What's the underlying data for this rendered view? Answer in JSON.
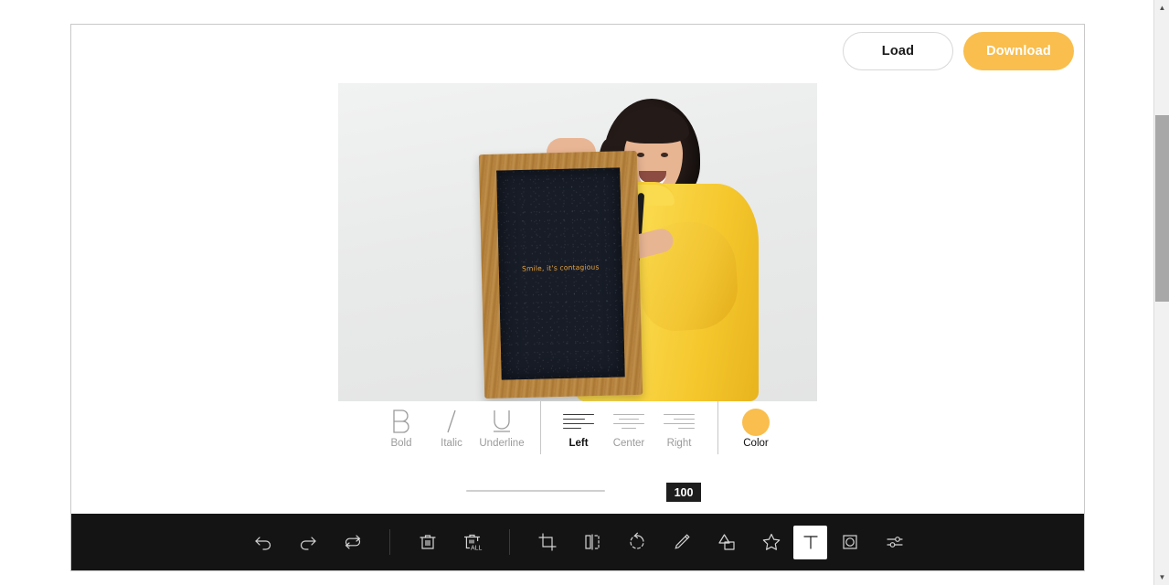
{
  "header": {
    "load_label": "Load",
    "download_label": "Download"
  },
  "canvas": {
    "board_text": "Smile, it's contagious",
    "photo_alt": "girl-in-yellow-jacket-holding-chalkboard"
  },
  "format_toolbar": {
    "items": [
      {
        "label": "Bold",
        "glyph": "B",
        "active": false,
        "name": "bold-button"
      },
      {
        "label": "Italic",
        "glyph": "I",
        "active": false,
        "name": "italic-button"
      },
      {
        "label": "Underline",
        "glyph": "U",
        "active": false,
        "name": "underline-button"
      }
    ],
    "align": [
      {
        "label": "Left",
        "active": true,
        "name": "align-left-button"
      },
      {
        "label": "Center",
        "active": false,
        "name": "align-center-button"
      },
      {
        "label": "Right",
        "active": false,
        "name": "align-right-button"
      }
    ],
    "color": {
      "label": "Color",
      "value": "#F9BE4D"
    }
  },
  "slider": {
    "value": "100",
    "min": "0",
    "max": "100"
  },
  "tools": [
    {
      "name": "undo-button",
      "icon": "undo-icon",
      "selected": false
    },
    {
      "name": "redo-button",
      "icon": "redo-icon",
      "selected": false
    },
    {
      "name": "reset-button",
      "icon": "reset-icon",
      "selected": false
    },
    {
      "name": "delete-button",
      "icon": "trash-icon",
      "selected": false
    },
    {
      "name": "delete-all-button",
      "icon": "trash-all-icon",
      "selected": false,
      "badge": "ALL"
    },
    {
      "name": "crop-button",
      "icon": "crop-icon",
      "selected": false
    },
    {
      "name": "flip-button",
      "icon": "flip-icon",
      "selected": false
    },
    {
      "name": "rotate-button",
      "icon": "rotate-icon",
      "selected": false
    },
    {
      "name": "draw-button",
      "icon": "pencil-icon",
      "selected": false
    },
    {
      "name": "shape-button",
      "icon": "shape-icon",
      "selected": false
    },
    {
      "name": "icon-button",
      "icon": "star-icon",
      "selected": false
    },
    {
      "name": "text-button",
      "icon": "text-icon",
      "selected": true
    },
    {
      "name": "mask-button",
      "icon": "mask-icon",
      "selected": false
    },
    {
      "name": "filter-button",
      "icon": "filter-icon",
      "selected": false
    }
  ],
  "scrollbar": {
    "up_arrow": "▲",
    "down_arrow": "▼"
  }
}
